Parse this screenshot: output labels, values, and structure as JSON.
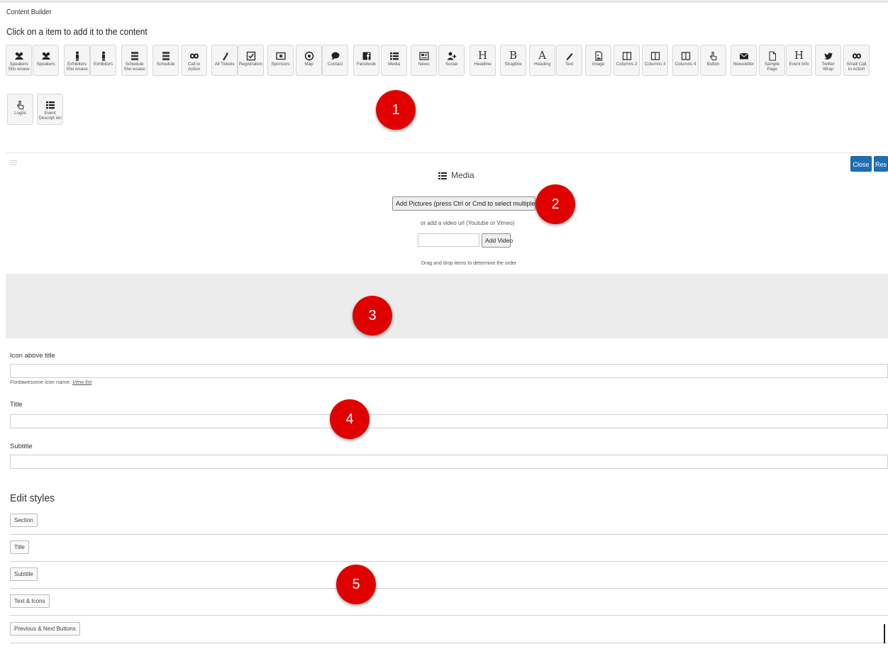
{
  "app_title": "Content Builder",
  "hint": "Click on a item to add it to the content",
  "palette": [
    {
      "label": "Speakers Sho wcase",
      "icon": "users-icon"
    },
    {
      "label": "Speakers",
      "icon": "users-icon"
    },
    {
      "label": "Exhibitors Sho wcase",
      "icon": "male-icon"
    },
    {
      "label": "Exhibitors",
      "icon": "male-icon"
    },
    {
      "label": "Schedule Sho wcase",
      "icon": "server-icon"
    },
    {
      "label": "Schedule",
      "icon": "server-icon"
    },
    {
      "label": "Call to Action",
      "icon": "infinity-icon"
    },
    {
      "label": "All Tickets",
      "icon": "ticket-icon"
    },
    {
      "label": "Registration",
      "icon": "check-square-icon"
    },
    {
      "label": "Sponsors",
      "icon": "money-icon"
    },
    {
      "label": "Map",
      "icon": "dot-circle-icon"
    },
    {
      "label": "Contact",
      "icon": "comment-icon"
    },
    {
      "label": "Facebook",
      "icon": "facebook-icon"
    },
    {
      "label": "Media",
      "icon": "list-icon"
    },
    {
      "label": "News",
      "icon": "newspaper-icon"
    },
    {
      "label": "Social",
      "icon": "user-plus-icon"
    },
    {
      "label": "Headline",
      "icon": "header-icon"
    },
    {
      "label": "Strapline",
      "icon": "bold-icon"
    },
    {
      "label": "Heading",
      "icon": "font-icon"
    },
    {
      "label": "Text",
      "icon": "pencil-icon"
    },
    {
      "label": "Image",
      "icon": "image-file-icon"
    },
    {
      "label": "Columns 2",
      "icon": "columns-icon"
    },
    {
      "label": "Columns 3",
      "icon": "columns-icon"
    },
    {
      "label": "Columns 4",
      "icon": "columns-icon"
    },
    {
      "label": "Button",
      "icon": "hand-pointer-icon"
    },
    {
      "label": "Newsletter",
      "icon": "envelope-icon"
    },
    {
      "label": "Sample Page",
      "icon": "file-icon"
    },
    {
      "label": "Event Info",
      "icon": "header-icon"
    },
    {
      "label": "Twitter Wrap",
      "icon": "twitter-icon"
    },
    {
      "label": "Small Call to Action",
      "icon": "infinity-icon"
    },
    {
      "label": "Logos",
      "icon": "hand-pointer-icon"
    },
    {
      "label": "Event Descript ion",
      "icon": "list-icon"
    }
  ],
  "panel": {
    "close_label": "Close",
    "reset_label": "Res",
    "media_title": "Media",
    "add_pictures_label": "Add Pictures (press Ctrl or Cmd to select multiple pictures)",
    "video_hint": "or add a video url (Youtube or Vimeo)",
    "add_video_label": "Add Video",
    "drag_hint": "Drag and drop items to determine the order",
    "icon_above_title_label": "Icon above title",
    "fontawesome_hint": "Fontawesome icon name.",
    "view_list_link": "View list",
    "title_label": "Title",
    "subtitle_label": "Subtitle",
    "edit_styles_heading": "Edit styles",
    "style_buttons": [
      "Section",
      "Title",
      "Subtitle",
      "Text & Icons",
      "Previous & Next Buttons"
    ]
  },
  "badges": [
    "1",
    "2",
    "3",
    "4",
    "5"
  ],
  "colors": {
    "accent": "#1f6fb5",
    "badge": "#e00000",
    "dropzone": "#ececec"
  }
}
